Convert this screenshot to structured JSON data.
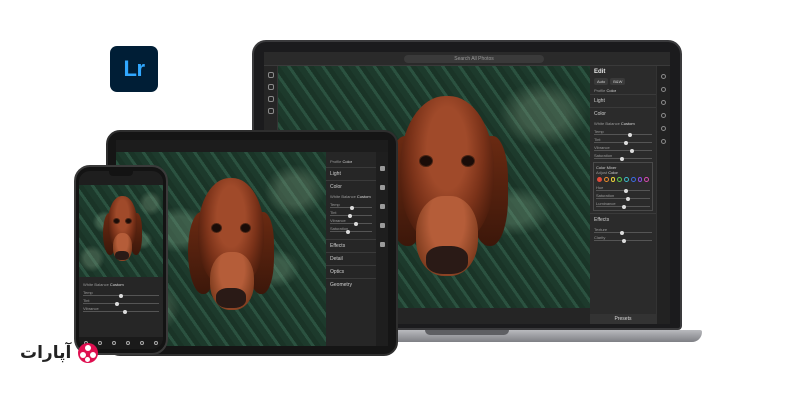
{
  "brand": {
    "app_logo_text": "Lr",
    "app_logo_bg": "#001e36",
    "app_logo_fg": "#31a8ff"
  },
  "laptop": {
    "search_placeholder": "Search All Photos",
    "panel": {
      "title": "Edit",
      "auto_label": "Auto",
      "bw_label": "B&W",
      "profile_label": "Profile",
      "profile_value": "Color",
      "sections": {
        "light": "Light",
        "color": "Color",
        "white_balance_label": "White Balance",
        "white_balance_value": "Custom",
        "temp": "Temp",
        "tint": "Tint",
        "vibrance": "Vibrance",
        "saturation": "Saturation",
        "color_mixer": "Color Mixer",
        "adjust": "Adjust",
        "adjust_value": "Color",
        "hue": "Hue",
        "mixer_saturation": "Saturation",
        "luminance": "Luminance",
        "effects": "Effects",
        "texture": "Texture",
        "clarity": "Clarity"
      },
      "presets_button": "Presets",
      "mixer_colors": [
        "#e04a3a",
        "#e88a2a",
        "#e8d03a",
        "#5ac84a",
        "#3ab8c8",
        "#3a6ae0",
        "#8a4ae0",
        "#d84ab0"
      ]
    }
  },
  "ipad": {
    "panel": {
      "sections": [
        "Light",
        "Color",
        "Effects",
        "Detail",
        "Optics",
        "Geometry"
      ],
      "profile_label": "Profile",
      "profile_value": "Color",
      "wb_label": "White Balance",
      "wb_value": "Custom",
      "sliders": [
        "Temp",
        "Tint",
        "Vibrance",
        "Saturation"
      ]
    }
  },
  "iphone": {
    "panel": {
      "wb_label": "White Balance",
      "wb_value": "Custom",
      "sliders": [
        "Temp",
        "Tint",
        "Vibrance"
      ]
    }
  },
  "watermark": {
    "text": "آپارات",
    "color": "#df0f50"
  }
}
